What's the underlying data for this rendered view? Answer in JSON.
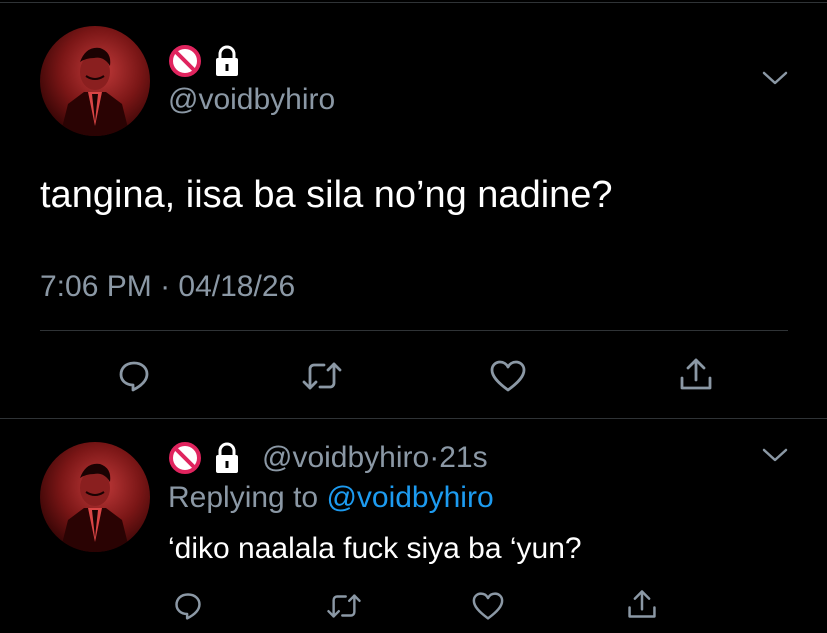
{
  "main_tweet": {
    "handle": "@voidbyhiro",
    "text": "tangina, iisa ba sila no’ng nadine?",
    "time": "7:06 PM",
    "separator": "·",
    "date": "04/18/26",
    "badges": [
      "no-entry-icon",
      "lock-icon"
    ]
  },
  "reply_tweet": {
    "handle": "@voidbyhiro",
    "separator": "·",
    "age": "21s",
    "replying_prefix": "Replying to",
    "replying_to": "@voidbyhiro",
    "text": "‘diko naalala fuck siya ba ‘yun?",
    "badges": [
      "no-entry-icon",
      "lock-icon"
    ]
  },
  "actions": [
    "reply-icon",
    "retweet-icon",
    "like-icon",
    "share-icon"
  ],
  "colors": {
    "background": "#000000",
    "text": "#ffffff",
    "secondary": "#8b98a5",
    "accent": "#1d9bf0",
    "divider": "#2f3336",
    "no_entry": "#e0245e"
  }
}
